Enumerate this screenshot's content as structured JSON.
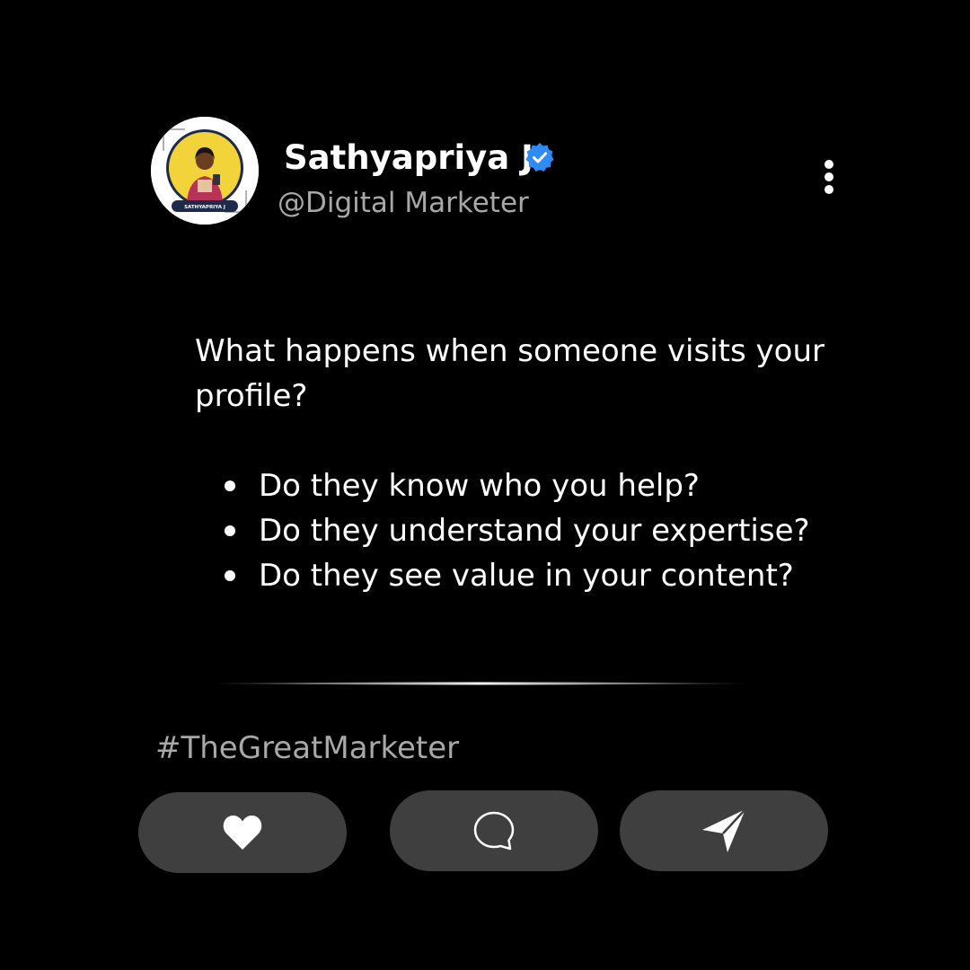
{
  "profile": {
    "name": "Sathyapriya J",
    "handle": "@Digital Marketer",
    "avatar_label": "SATHYAPRIYA J",
    "verified_icon": "verified-badge-icon",
    "verified_color": "#2f8bf5"
  },
  "menu_icon": "more-vertical-icon",
  "post": {
    "intro": "What happens when someone visits your\nprofile?",
    "bullets": [
      "Do they know who you help?",
      "Do they understand your expertise?",
      "Do they see value in your content?"
    ]
  },
  "hashtag": "#TheGreatMarketer",
  "actions": [
    {
      "icon": "heart-icon"
    },
    {
      "icon": "comment-icon"
    },
    {
      "icon": "send-icon"
    }
  ],
  "colors": {
    "background": "#000000",
    "text": "#ffffff",
    "muted_text": "#a8a8a8",
    "button_bg": "#3f3f3f",
    "avatar_ring": "#f2d33a"
  }
}
